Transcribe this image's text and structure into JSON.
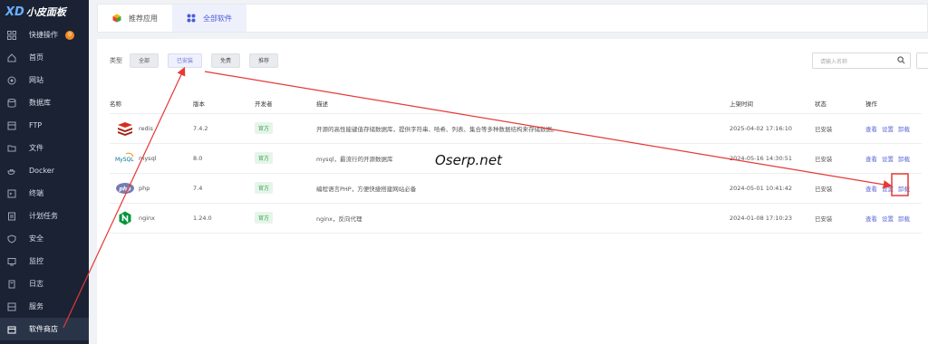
{
  "brand": {
    "mark": "XD",
    "name": "小皮面板"
  },
  "sidebar": {
    "items": [
      {
        "label": "快捷操作",
        "icon": "grid-icon",
        "badge": "0"
      },
      {
        "label": "首页",
        "icon": "home-icon"
      },
      {
        "label": "网站",
        "icon": "globe-icon"
      },
      {
        "label": "数据库",
        "icon": "database-icon"
      },
      {
        "label": "FTP",
        "icon": "ftp-icon"
      },
      {
        "label": "文件",
        "icon": "folder-icon"
      },
      {
        "label": "Docker",
        "icon": "docker-icon"
      },
      {
        "label": "终端",
        "icon": "terminal-icon"
      },
      {
        "label": "计划任务",
        "icon": "task-icon"
      },
      {
        "label": "安全",
        "icon": "shield-icon"
      },
      {
        "label": "监控",
        "icon": "monitor-icon"
      },
      {
        "label": "日志",
        "icon": "log-icon"
      },
      {
        "label": "服务",
        "icon": "service-icon"
      },
      {
        "label": "软件商店",
        "icon": "store-icon",
        "active": true
      }
    ]
  },
  "tabs": [
    {
      "label": "推荐应用",
      "icon": "cube-icon"
    },
    {
      "label": "全部软件",
      "icon": "apps-icon",
      "active": true
    }
  ],
  "filter": {
    "label": "类型",
    "options": [
      "全部",
      "已安装",
      "免费",
      "推荐"
    ],
    "selected": "已安装"
  },
  "search": {
    "placeholder": "请输入名称"
  },
  "table": {
    "columns": [
      "名称",
      "版本",
      "开发者",
      "描述",
      "上架时间",
      "状态",
      "操作"
    ],
    "rows": [
      {
        "name": "redis",
        "logo": "redis-logo",
        "version": "7.4.2",
        "developer": "官方",
        "description": "开源的高性能键值存储数据库，提供字符串、哈希、列表、集合等多种数据结构来存储数据。",
        "date": "2025-04-02 17:16:10",
        "status": "已安装",
        "actions": [
          "查看",
          "设置",
          "卸载"
        ]
      },
      {
        "name": "mysql",
        "logo": "mysql-logo",
        "version": "8.0",
        "developer": "官方",
        "description": "mysql，最流行的开源数据库",
        "date": "2024-05-16 14:30:51",
        "status": "已安装",
        "actions": [
          "查看",
          "设置",
          "卸载"
        ]
      },
      {
        "name": "php",
        "logo": "php-logo",
        "version": "7.4",
        "developer": "官方",
        "description": "编程语言PHP，方便快捷搭建网站必备",
        "date": "2024-05-01 10:41:42",
        "status": "已安装",
        "actions": [
          "查看",
          "设置",
          "卸载"
        ]
      },
      {
        "name": "nginx",
        "logo": "nginx-logo",
        "version": "1.24.0",
        "developer": "官方",
        "description": "nginx，反向代理",
        "date": "2024-01-08 17:10:23",
        "status": "已安装",
        "actions": [
          "查看",
          "设置",
          "卸载"
        ]
      }
    ]
  },
  "watermark": "Oserp.net",
  "colors": {
    "sidebar": "#1a2234",
    "accent": "#4a5bdc",
    "annotation": "#e53935"
  }
}
